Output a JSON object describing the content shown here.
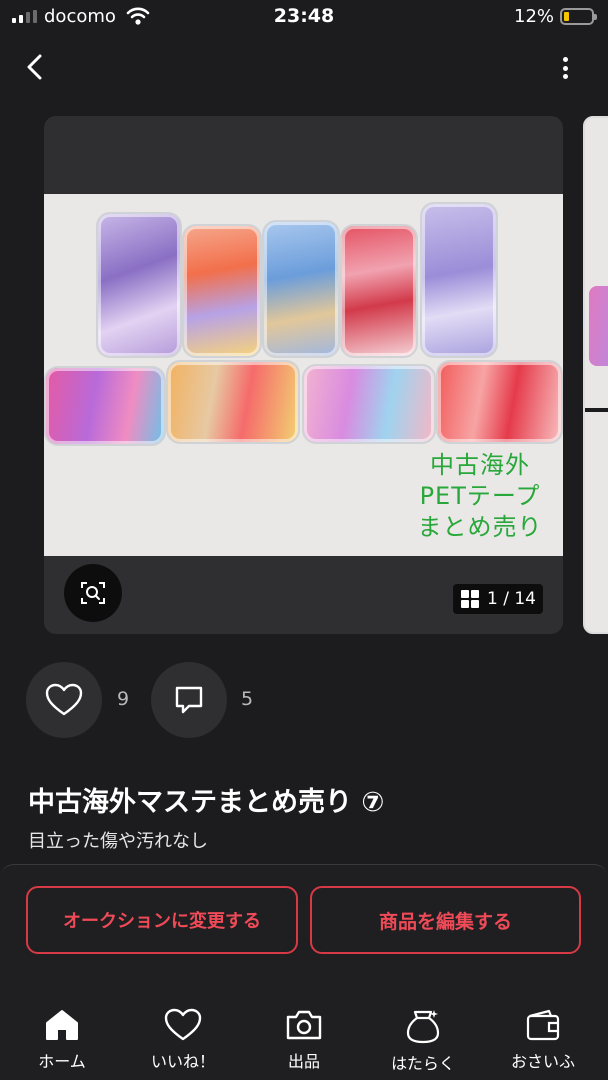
{
  "status_bar": {
    "carrier": "docomo",
    "time": "23:48",
    "battery": "12%",
    "battery_level": 0.12
  },
  "photo": {
    "caption_lines": [
      "中古海外",
      "PETテープ",
      "まとめ売り"
    ],
    "counter": "1 / 14"
  },
  "stats": {
    "likes": "9",
    "comments": "5"
  },
  "item": {
    "title": "中古海外マステまとめ売り ⑦",
    "condition": "目立った傷や汚れなし"
  },
  "buttons": {
    "auction": "オークションに変更する",
    "edit": "商品を編集する"
  },
  "tabs": [
    {
      "label": "ホーム",
      "icon": "home-icon",
      "active": true
    },
    {
      "label": "いいね！",
      "icon": "heart-icon"
    },
    {
      "label": "出品",
      "icon": "camera-icon"
    },
    {
      "label": "はたらく",
      "icon": "money-bag-icon"
    },
    {
      "label": "おさいふ",
      "icon": "wallet-icon"
    }
  ],
  "colors": {
    "accent": "#ef4a57",
    "background": "#1c1c1e",
    "card": "#2f2f31",
    "caption_green": "#29a73a",
    "battery_yellow": "#f5c400"
  }
}
